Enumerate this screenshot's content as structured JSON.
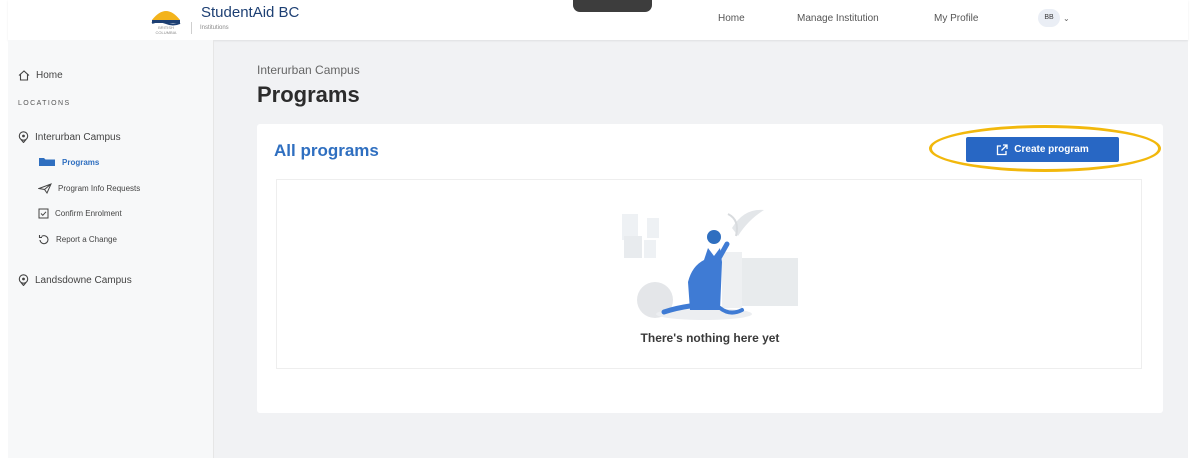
{
  "header": {
    "brand_name": "StudentAid BC",
    "brand_sub": "Institutions",
    "logo_text": "BRITISH COLUMBIA",
    "nav": [
      "Home",
      "Manage Institution",
      "My Profile"
    ],
    "user_initials": "BB"
  },
  "sidebar": {
    "home": "Home",
    "section_label": "LOCATIONS",
    "location_1": "Interurban Campus",
    "location_1_items": [
      "Programs",
      "Program Info Requests",
      "Confirm Enrolment",
      "Report a Change"
    ],
    "location_2": "Landsdowne Campus"
  },
  "main": {
    "breadcrumb": "Interurban Campus",
    "title": "Programs",
    "card_title": "All programs",
    "create_button": "Create program",
    "empty_message": "There's nothing here yet"
  },
  "colors": {
    "accent": "#2867c4",
    "highlight": "#f2b80c",
    "brand": "#1d3f73"
  }
}
